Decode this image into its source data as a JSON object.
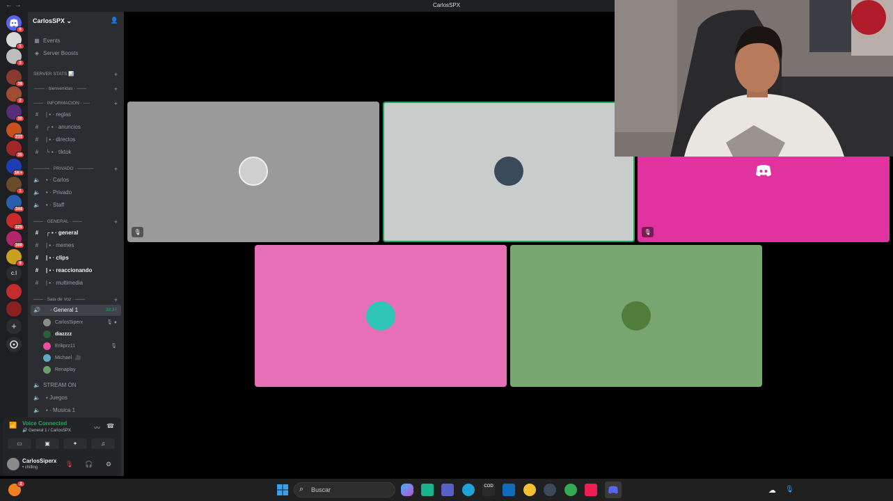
{
  "window": {
    "title": "CarlosSPX",
    "back_glyph": "← →"
  },
  "server_rail": {
    "servers": [
      {
        "icon": "discord-home-icon",
        "badge": "6",
        "color": "#5865f2"
      },
      {
        "icon": "server-skull-icon",
        "badge": "1",
        "color": "#d9d9d9"
      },
      {
        "icon": "server-skull-2-icon",
        "badge": "3",
        "color": "#bdbdbd"
      },
      {
        "icon": "server-icon",
        "badge": "38",
        "color": "#8b3a2f"
      },
      {
        "icon": "server-icon",
        "badge": "2",
        "color": "#a04b32"
      },
      {
        "icon": "server-icon",
        "badge": "30",
        "color": "#5a2d7a"
      },
      {
        "icon": "server-icon",
        "badge": "233",
        "color": "#c8501e"
      },
      {
        "icon": "server-icon",
        "badge": "35",
        "color": "#a12828"
      },
      {
        "icon": "server-icon",
        "badge": "1K+",
        "color": "#1d3fb3"
      },
      {
        "icon": "server-icon",
        "badge": "1",
        "color": "#6a4b2b"
      },
      {
        "icon": "server-icon",
        "badge": "344",
        "color": "#2a5fb0"
      },
      {
        "icon": "server-icon",
        "badge": "325",
        "color": "#c92a2a"
      },
      {
        "icon": "server-icon",
        "badge": "300",
        "color": "#b0286b"
      },
      {
        "icon": "server-icon",
        "badge": "9",
        "color": "#c8a11e"
      },
      {
        "icon": "server-text-icon",
        "badge": "",
        "color": "#2b2d31",
        "text": "c.l"
      },
      {
        "icon": "server-icon",
        "badge": "",
        "color": "#c42d2d"
      },
      {
        "icon": "server-icon",
        "badge": "",
        "color": "#8c1f1f"
      }
    ],
    "add_server_icon": "plus-icon",
    "discover_icon": "compass-icon"
  },
  "sidebar": {
    "server_name": "CarlosSPX",
    "top_items": [
      {
        "label": "Events",
        "icon": "calendar-icon"
      },
      {
        "label": "Server Boosts",
        "icon": "boost-icon"
      }
    ],
    "categories": {
      "server_stats": "SERVER STATS 📊",
      "bienvenidas": "·─── · bienvenidas · ───",
      "informacion": "─── · INFORMACION · ──",
      "privado": "───── · PRIVADO · ─────",
      "general": "─── · GENERAL · ───",
      "sala_voz": "─── · Sala de Voz · ───"
    },
    "info_channels": [
      "reglas",
      "anuncios",
      "directos",
      "tiktok"
    ],
    "private_channels": [
      "Carlos",
      "Privado",
      "Staff"
    ],
    "general_channels": [
      "general",
      "memes",
      "clips",
      "reaccionando",
      "multimedia"
    ],
    "voice_channel": {
      "name": "General 1",
      "timer": "38:37"
    },
    "voice_users": [
      {
        "name": "CarlosSiperx",
        "color": "#8a8a8a",
        "status": "🎙 ●"
      },
      {
        "name": "diazzzz",
        "color": "#2f5d3a",
        "status": ""
      },
      {
        "name": "Erikprz11",
        "color": "#e84fa0",
        "status": "🎙"
      },
      {
        "name": "Michael",
        "color": "#5fa8c8",
        "status": "🎥"
      },
      {
        "name": "Renaplay",
        "color": "#6aa06a",
        "status": ""
      }
    ],
    "extra_voice": [
      "STREAM ON",
      "Juegos",
      "Musica 1"
    ]
  },
  "voice_panel": {
    "status": "Voice Connected",
    "location": "General 1 / CarlosSPX",
    "buttons": [
      "camera-off-icon",
      "screen-share-icon",
      "activities-icon",
      "soundboard-icon"
    ]
  },
  "user_panel": {
    "name": "CarlosSiperx",
    "status": "chilling"
  },
  "call": {
    "tiles": [
      {
        "color": "#9a9a9a",
        "avatar_color": "#cfcfcf",
        "muted": true,
        "highlight": false
      },
      {
        "color": "#c8cdcc",
        "avatar_color": "#3a4a58",
        "muted": false,
        "highlight": true
      },
      {
        "color": "#e033a0",
        "avatar_color": "",
        "muted": true,
        "highlight": false
      },
      {
        "color": "#e66fb5",
        "avatar_color": "#2ec4b6",
        "muted": false,
        "highlight": false
      },
      {
        "color": "#78a670",
        "avatar_color": "#4f7d3a",
        "muted": false,
        "highlight": false
      }
    ]
  },
  "taskbar": {
    "search_placeholder": "Buscar",
    "apps": [
      "windows-start-icon",
      "copilot-icon",
      "store-icon",
      "teams-icon",
      "edge-icon",
      "call-of-duty-icon",
      "outlook-icon",
      "chrome-icon",
      "steam-icon",
      "chrome-2-icon",
      "tiktok-icon",
      "discord-icon"
    ],
    "tray": [
      "cloud-icon",
      "mic-icon"
    ],
    "left_badge": "2"
  }
}
